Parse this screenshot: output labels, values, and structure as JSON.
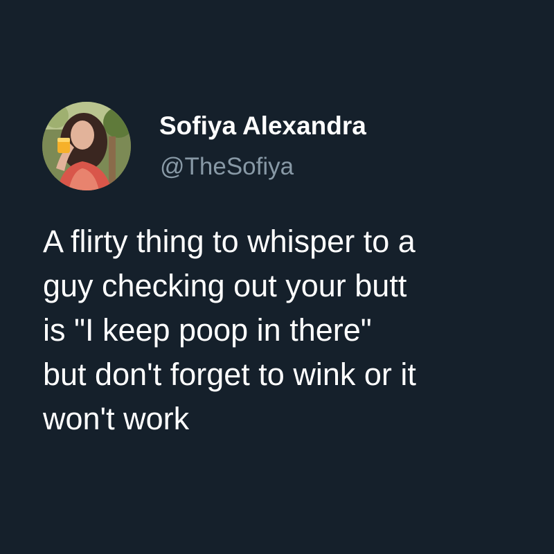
{
  "theme": {
    "background": "#15202b",
    "text_primary": "#ffffff",
    "text_secondary": "#8899a6"
  },
  "author": {
    "display_name": "Sofiya Alexandra",
    "handle": "@TheSofiya",
    "avatar": "profile-photo-avatar"
  },
  "tweet": {
    "lines": [
      "A flirty thing to whisper to a",
      "guy checking out your butt",
      "is \"I keep poop in there\"",
      "but don't forget to wink or it",
      "won't work"
    ]
  }
}
